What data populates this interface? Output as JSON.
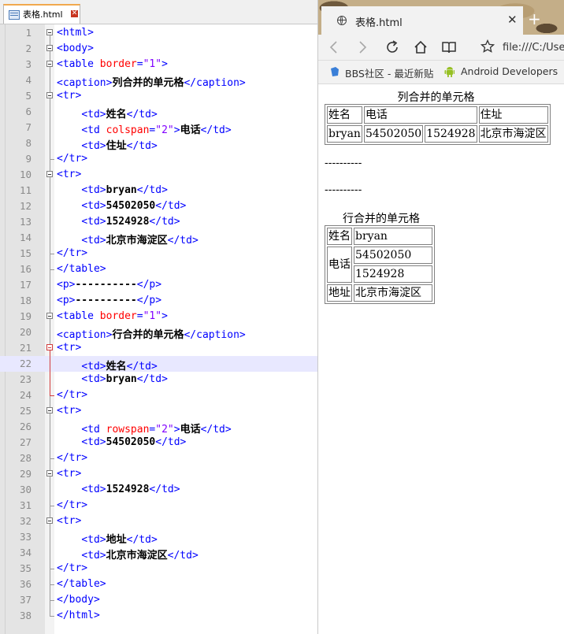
{
  "editor": {
    "tab_label": "表格.html",
    "lines": [
      {
        "n": "1",
        "html": "<span class=\"tg\">&lt;html&gt;</span>"
      },
      {
        "n": "2",
        "html": "<span class=\"tg\">&lt;body&gt;</span>"
      },
      {
        "n": "3",
        "html": "<span class=\"tg\">&lt;table </span><span class=\"at\">border</span><span class=\"tg\">=</span><span class=\"av\">\"1\"</span><span class=\"tg\">&gt;</span>"
      },
      {
        "n": "4",
        "html": "<span class=\"tg\">&lt;caption&gt;</span><span class=\"tx\">列合并的单元格</span><span class=\"tg\">&lt;/caption&gt;</span>"
      },
      {
        "n": "5",
        "html": "<span class=\"tg\">&lt;tr&gt;</span>"
      },
      {
        "n": "6",
        "html": "    <span class=\"tg\">&lt;td&gt;</span><span class=\"tx\">姓名</span><span class=\"tg\">&lt;/td&gt;</span>"
      },
      {
        "n": "7",
        "html": "    <span class=\"tg\">&lt;td </span><span class=\"at\">colspan</span><span class=\"tg\">=</span><span class=\"av\">\"2\"</span><span class=\"tg\">&gt;</span><span class=\"tx\">电话</span><span class=\"tg\">&lt;/td&gt;</span>"
      },
      {
        "n": "8",
        "html": "    <span class=\"tg\">&lt;td&gt;</span><span class=\"tx\">住址</span><span class=\"tg\">&lt;/td&gt;</span>"
      },
      {
        "n": "9",
        "html": "<span class=\"tg\">&lt;/tr&gt;</span>"
      },
      {
        "n": "10",
        "html": "<span class=\"tg\">&lt;tr&gt;</span>"
      },
      {
        "n": "11",
        "html": "    <span class=\"tg\">&lt;td&gt;</span><span class=\"tx\">bryan</span><span class=\"tg\">&lt;/td&gt;</span>"
      },
      {
        "n": "12",
        "html": "    <span class=\"tg\">&lt;td&gt;</span><span class=\"tx\">54502050</span><span class=\"tg\">&lt;/td&gt;</span>"
      },
      {
        "n": "13",
        "html": "    <span class=\"tg\">&lt;td&gt;</span><span class=\"tx\">1524928</span><span class=\"tg\">&lt;/td&gt;</span>"
      },
      {
        "n": "14",
        "html": "    <span class=\"tg\">&lt;td&gt;</span><span class=\"tx\">北京市海淀区</span><span class=\"tg\">&lt;/td&gt;</span>"
      },
      {
        "n": "15",
        "html": "<span class=\"tg\">&lt;/tr&gt;</span>"
      },
      {
        "n": "16",
        "html": "<span class=\"tg\">&lt;/table&gt;</span>"
      },
      {
        "n": "17",
        "html": "<span class=\"tg\">&lt;p&gt;</span><span class=\"tx\">----------</span><span class=\"tg\">&lt;/p&gt;</span>"
      },
      {
        "n": "18",
        "html": "<span class=\"tg\">&lt;p&gt;</span><span class=\"tx\">----------</span><span class=\"tg\">&lt;/p&gt;</span>"
      },
      {
        "n": "19",
        "html": "<span class=\"tg\">&lt;table </span><span class=\"at\">border</span><span class=\"tg\">=</span><span class=\"av\">\"1\"</span><span class=\"tg\">&gt;</span>"
      },
      {
        "n": "20",
        "html": "<span class=\"tg\">&lt;caption&gt;</span><span class=\"tx\">行合并的单元格</span><span class=\"tg\">&lt;/caption&gt;</span>"
      },
      {
        "n": "21",
        "html": "<span class=\"tg\">&lt;tr&gt;</span>"
      },
      {
        "n": "22",
        "html": "    <span class=\"tg\">&lt;td&gt;</span><span class=\"tx\">姓名</span><span class=\"tg\">&lt;/td&gt;</span>"
      },
      {
        "n": "23",
        "html": "    <span class=\"tg\">&lt;td&gt;</span><span class=\"tx\">bryan</span><span class=\"tg\">&lt;/td&gt;</span>"
      },
      {
        "n": "24",
        "html": "<span class=\"tg\">&lt;/tr&gt;</span>"
      },
      {
        "n": "25",
        "html": "<span class=\"tg\">&lt;tr&gt;</span>"
      },
      {
        "n": "26",
        "html": "    <span class=\"tg\">&lt;td </span><span class=\"at\">rowspan</span><span class=\"tg\">=</span><span class=\"av\">\"2\"</span><span class=\"tg\">&gt;</span><span class=\"tx\">电话</span><span class=\"tg\">&lt;/td&gt;</span>"
      },
      {
        "n": "27",
        "html": "    <span class=\"tg\">&lt;td&gt;</span><span class=\"tx\">54502050</span><span class=\"tg\">&lt;/td&gt;</span>"
      },
      {
        "n": "28",
        "html": "<span class=\"tg\">&lt;/tr&gt;</span>"
      },
      {
        "n": "29",
        "html": "<span class=\"tg\">&lt;tr&gt;</span>"
      },
      {
        "n": "30",
        "html": "    <span class=\"tg\">&lt;td&gt;</span><span class=\"tx\">1524928</span><span class=\"tg\">&lt;/td&gt;</span>"
      },
      {
        "n": "31",
        "html": "<span class=\"tg\">&lt;/tr&gt;</span>"
      },
      {
        "n": "32",
        "html": "<span class=\"tg\">&lt;tr&gt;</span>"
      },
      {
        "n": "33",
        "html": "    <span class=\"tg\">&lt;td&gt;</span><span class=\"tx\">地址</span><span class=\"tg\">&lt;/td&gt;</span>"
      },
      {
        "n": "34",
        "html": "    <span class=\"tg\">&lt;td&gt;</span><span class=\"tx\">北京市海淀区</span><span class=\"tg\">&lt;/td&gt;</span>"
      },
      {
        "n": "35",
        "html": "<span class=\"tg\">&lt;/tr&gt;</span>"
      },
      {
        "n": "36",
        "html": "<span class=\"tg\">&lt;/table&gt;</span>"
      },
      {
        "n": "37",
        "html": "<span class=\"tg\">&lt;/body&gt;</span>"
      },
      {
        "n": "38",
        "html": "<span class=\"tg\">&lt;/html&gt;</span>"
      }
    ]
  },
  "browser": {
    "tab_title": "表格.html",
    "close_glyph": "✕",
    "newtab_glyph": "+",
    "address": "file:///C:/Use",
    "favorites": [
      "BBS社区 - 最近新贴",
      "Android Developers"
    ]
  },
  "page": {
    "table1": {
      "caption": "列合并的单元格",
      "header": [
        "姓名",
        "电话",
        "住址"
      ],
      "row": [
        "bryan",
        "54502050",
        "1524928",
        "北京市海淀区"
      ]
    },
    "separator1": "----------",
    "separator2": "----------",
    "table2": {
      "caption": "行合并的单元格",
      "name_label": "姓名",
      "name_value": "bryan",
      "phone_label": "电话",
      "phone1": "54502050",
      "phone2": "1524928",
      "addr_label": "地址",
      "addr_value": "北京市海淀区"
    }
  }
}
